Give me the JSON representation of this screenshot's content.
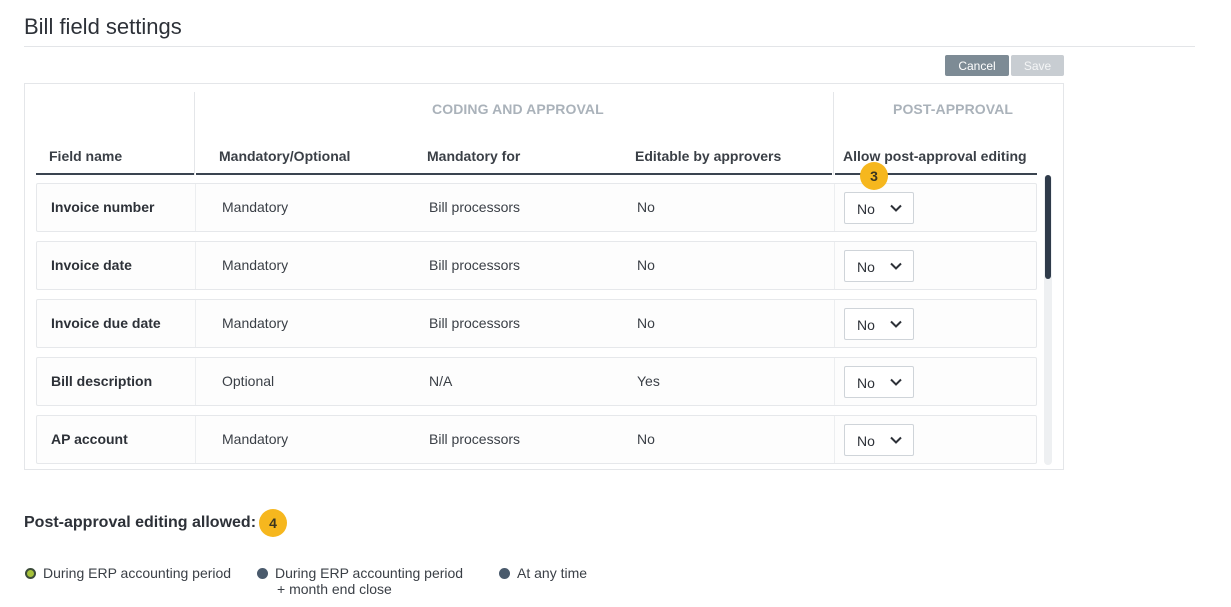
{
  "page": {
    "title": "Bill field settings"
  },
  "toolbar": {
    "cancel_label": "Cancel",
    "save_label": "Save"
  },
  "table": {
    "groups": {
      "coding": "CODING AND APPROVAL",
      "post": "POST-APPROVAL"
    },
    "columns": {
      "field_name": "Field name",
      "mandatory_optional": "Mandatory/Optional",
      "mandatory_for": "Mandatory for",
      "editable_by_approvers": "Editable by approvers",
      "allow_post_approval": "Allow post-approval editing"
    },
    "badge_post": "3",
    "rows": [
      {
        "name": "Invoice number",
        "mandatory": "Mandatory",
        "for": "Bill processors",
        "editable": "No",
        "allow": "No"
      },
      {
        "name": "Invoice date",
        "mandatory": "Mandatory",
        "for": "Bill processors",
        "editable": "No",
        "allow": "No"
      },
      {
        "name": "Invoice due date",
        "mandatory": "Mandatory",
        "for": "Bill processors",
        "editable": "No",
        "allow": "No"
      },
      {
        "name": "Bill description",
        "mandatory": "Optional",
        "for": "N/A",
        "editable": "Yes",
        "allow": "No"
      },
      {
        "name": "AP account",
        "mandatory": "Mandatory",
        "for": "Bill processors",
        "editable": "No",
        "allow": "No"
      }
    ]
  },
  "post_approval": {
    "title": "Post-approval editing allowed:",
    "badge": "4",
    "options": [
      {
        "label": "During ERP accounting period",
        "sub": "",
        "selected": true
      },
      {
        "label": "During ERP accounting period",
        "sub": "+ month end close",
        "selected": false
      },
      {
        "label": "At any time",
        "sub": "",
        "selected": false
      }
    ]
  },
  "colors": {
    "badge": "#f6b71e",
    "selected_radio": "#a6c23a",
    "header_rule": "#3a4450"
  }
}
